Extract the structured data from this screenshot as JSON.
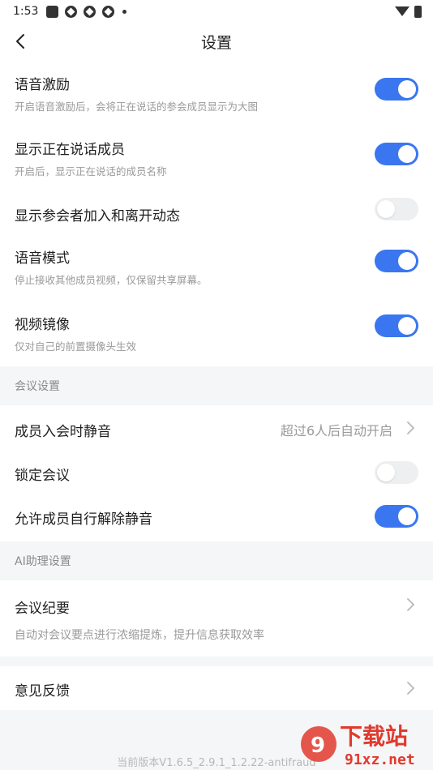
{
  "status_bar": {
    "time": "1:53"
  },
  "nav": {
    "title": "设置"
  },
  "general": [
    {
      "label": "语音激励",
      "desc": "开启语音激励后，会将正在说话的参会成员显示为大图",
      "on": true
    },
    {
      "label": "显示正在说话成员",
      "desc": "开启后，显示正在说话的成员名称",
      "on": true
    },
    {
      "label": "显示参会者加入和离开动态",
      "desc": "",
      "on": false
    },
    {
      "label": "语音模式",
      "desc": "停止接收其他成员视频，仅保留共享屏幕。",
      "on": true
    },
    {
      "label": "视频镜像",
      "desc": "仅对自己的前置摄像头生效",
      "on": true
    }
  ],
  "meeting_settings": {
    "header": "会议设置",
    "mute_on_join": {
      "label": "成员入会时静音",
      "value": "超过6人后自动开启"
    },
    "lock_meeting": {
      "label": "锁定会议",
      "on": false
    },
    "allow_unmute": {
      "label": "允许成员自行解除静音",
      "on": true
    }
  },
  "ai_settings": {
    "header": "AI助理设置",
    "summary": {
      "label": "会议纪要",
      "desc": "自动对会议要点进行浓缩提炼，提升信息获取效率"
    }
  },
  "feedback": {
    "label": "意见反馈"
  },
  "version": "当前版本V1.6.5_2.9.1_1.2.22-antifraud",
  "watermark": {
    "brand": "下载站",
    "domain": "91xz.net"
  },
  "colors": {
    "accent": "#3a76f0",
    "toggle_off": "#eeeff1",
    "background": "#f5f6f7"
  }
}
